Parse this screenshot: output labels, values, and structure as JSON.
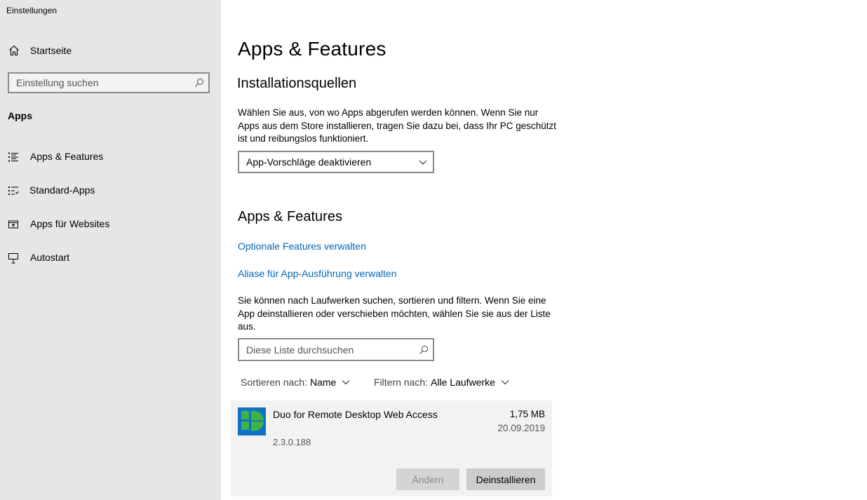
{
  "window": {
    "title": "Einstellungen"
  },
  "sidebar": {
    "home_label": "Startseite",
    "search_placeholder": "Einstellung suchen",
    "section": "Apps",
    "items": [
      {
        "label": "Apps & Features",
        "icon": "list-icon"
      },
      {
        "label": "Standard-Apps",
        "icon": "default-apps-icon"
      },
      {
        "label": "Apps für Websites",
        "icon": "open-in-app-icon"
      },
      {
        "label": "Autostart",
        "icon": "startup-icon"
      }
    ]
  },
  "main": {
    "title": "Apps & Features",
    "install_sources": {
      "heading": "Installationsquellen",
      "description": "Wählen Sie aus, von wo Apps abgerufen werden können. Wenn Sie nur Apps aus dem Store installieren, tragen Sie dazu bei, dass Ihr PC geschützt ist und reibungslos funktioniert.",
      "dropdown_value": "App-Vorschläge deaktivieren"
    },
    "apps_features": {
      "heading": "Apps & Features",
      "link_optional": "Optionale Features verwalten",
      "link_alias": "Aliase für App-Ausführung verwalten",
      "description": "Sie können nach Laufwerken suchen, sortieren und filtern. Wenn Sie eine App deinstallieren oder verschieben möchten, wählen Sie sie aus der Liste aus.",
      "search_placeholder": "Diese Liste durchsuchen",
      "sort_label": "Sortieren nach:",
      "sort_value": "Name",
      "filter_label": "Filtern nach:",
      "filter_value": "Alle Laufwerke"
    },
    "apps": [
      {
        "name": "Duo for Remote Desktop Web Access",
        "version": "2.3.0.188",
        "size": "1,75 MB",
        "date": "20.09.2019",
        "change_label": "Ändern",
        "uninstall_label": "Deinstallieren"
      }
    ]
  },
  "colors": {
    "link": "#0067b8",
    "sidebar_bg": "#e6e6e6",
    "app_icon_bg": "#0e72c7",
    "app_icon_fg": "#3fb24a"
  }
}
